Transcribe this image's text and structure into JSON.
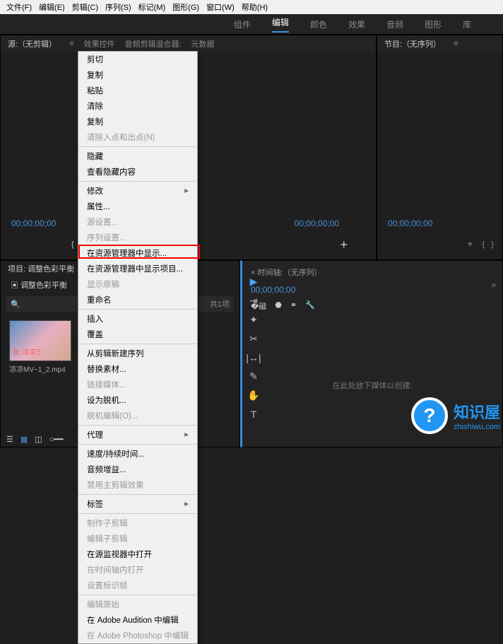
{
  "menubar": [
    "文件(F)",
    "编辑(E)",
    "剪辑(C)",
    "序列(S)",
    "标记(M)",
    "图形(G)",
    "窗口(W)",
    "帮助(H)"
  ],
  "workspaces": {
    "items": [
      "组件",
      "编辑",
      "颜色",
      "效果",
      "音频",
      "图形",
      "库"
    ],
    "active": "编辑"
  },
  "source": {
    "tabs": [
      "源:（无剪辑）",
      "效果控件",
      "音频剪辑混合器:",
      "元数据"
    ],
    "tc_left": "00;00;00;00",
    "tc_right": "00;00;00;00"
  },
  "program": {
    "title": "节目:（无序列）",
    "tc": "00;00;00;00"
  },
  "context_menu": [
    {
      "t": "剪切"
    },
    {
      "t": "复制"
    },
    {
      "t": "粘贴"
    },
    {
      "t": "清除"
    },
    {
      "t": "复制"
    },
    {
      "t": "清除入点和出点(N)",
      "d": true
    },
    "-",
    {
      "t": "隐藏"
    },
    {
      "t": "查看隐藏内容"
    },
    "-",
    {
      "t": "修改",
      "a": true
    },
    {
      "t": "属性..."
    },
    {
      "t": "源设置...",
      "d": true
    },
    {
      "t": "序列设置...",
      "d": true
    },
    {
      "t": "在资源管理器中显示..."
    },
    {
      "t": "在资源管理器中显示项目..."
    },
    {
      "t": "显示原稿",
      "d": true
    },
    {
      "t": "重命名"
    },
    "-",
    {
      "t": "插入"
    },
    {
      "t": "覆盖"
    },
    "-",
    {
      "t": "从剪辑新建序列"
    },
    {
      "t": "替换素材..."
    },
    {
      "t": "链接媒体...",
      "d": true
    },
    {
      "t": "设为脱机..."
    },
    {
      "t": "脱机编辑(O)...",
      "d": true
    },
    "-",
    {
      "t": "代理",
      "a": true
    },
    "-",
    {
      "t": "速度/持续时间..."
    },
    {
      "t": "音频增益..."
    },
    {
      "t": "禁用主剪辑效果",
      "d": true
    },
    "-",
    {
      "t": "标签",
      "a": true
    },
    "-",
    {
      "t": "制作子剪辑",
      "d": true
    },
    {
      "t": "编辑子剪辑",
      "d": true
    },
    {
      "t": "在源监视器中打开"
    },
    {
      "t": "在时间轴内打开",
      "d": true
    },
    {
      "t": "设置标识帧",
      "d": true
    },
    "-",
    {
      "t": "编辑原始",
      "d": true
    },
    {
      "t": "在 Adobe Audition 中编辑"
    },
    {
      "t": "在 Adobe Photoshop 中编辑",
      "d": true
    }
  ],
  "project": {
    "tab": "项目: 调整色彩平衡",
    "info": "调整色彩平衡",
    "count_suffix": "共1项",
    "clip": "凉凉MV~1_2.mp4"
  },
  "timeline": {
    "title": "× 时间轴:（无序列）",
    "tc": "00;00;00;00",
    "empty": "在此处放下媒体以创建:"
  },
  "watermark": {
    "name": "知识屋",
    "url": "zhishiwu.com"
  }
}
